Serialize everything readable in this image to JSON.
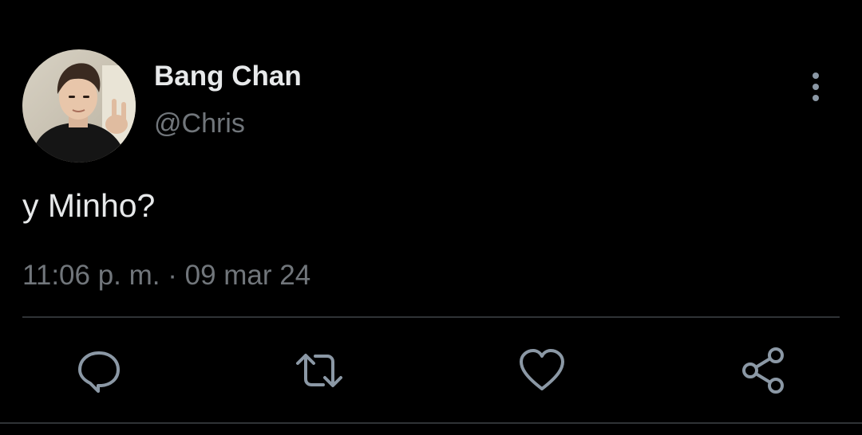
{
  "tweet": {
    "author": {
      "display_name": "Bang Chan",
      "handle": "@Chris",
      "avatar_icon": "profile-photo"
    },
    "text": "y Minho?",
    "timestamp": "11:06 p. m. · 09 mar 24"
  },
  "icons": {
    "more": "more-vertical-icon",
    "reply": "reply-icon",
    "retweet": "retweet-icon",
    "like": "heart-icon",
    "share": "share-icon"
  },
  "colors": {
    "background": "#000000",
    "primary_text": "#e7e9ea",
    "secondary_text": "#71767b",
    "divider": "#2f3336",
    "icon": "#8b98a5"
  }
}
